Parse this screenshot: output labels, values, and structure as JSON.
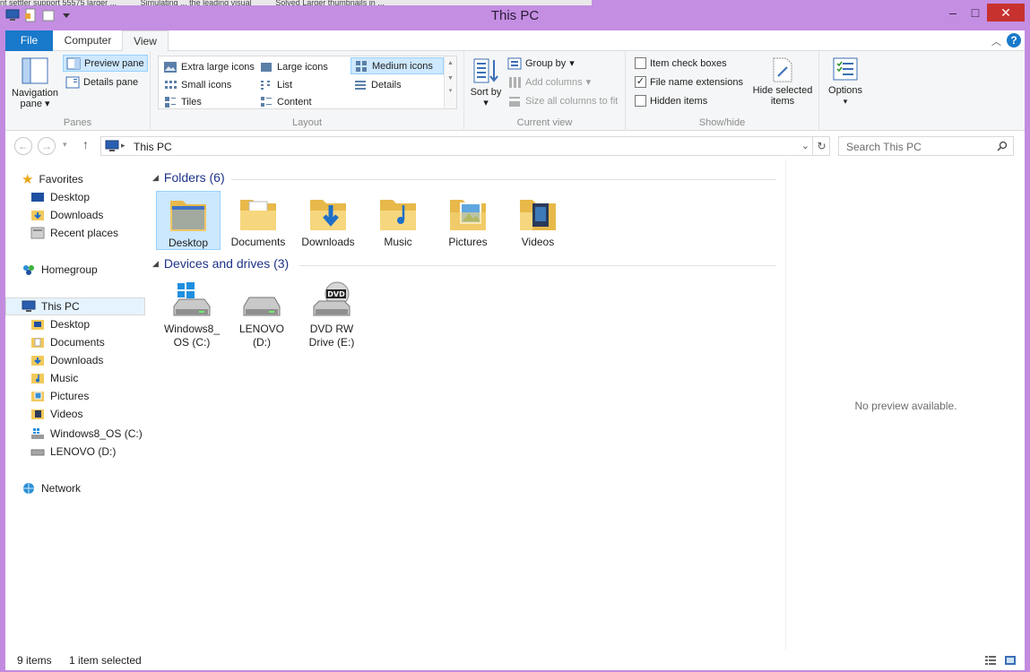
{
  "background_strip": [
    "nt settler support 55575 larger ...",
    "Simulating ... the leading visual",
    "Solved Larger thumbnails in ..."
  ],
  "window": {
    "title": "This PC",
    "minimize": "–",
    "maximize": "□",
    "close": "✕"
  },
  "ribbon": {
    "tabs": {
      "file": "File",
      "computer": "Computer",
      "view": "View"
    },
    "help": "?",
    "panes": {
      "label": "Panes",
      "navigation_pane": "Navigation pane",
      "preview_pane": "Preview pane",
      "details_pane": "Details pane"
    },
    "layout": {
      "label": "Layout",
      "extra_large_icons": "Extra large icons",
      "large_icons": "Large icons",
      "medium_icons": "Medium icons",
      "small_icons": "Small icons",
      "list": "List",
      "details": "Details",
      "tiles": "Tiles",
      "content": "Content"
    },
    "current_view": {
      "label": "Current view",
      "sort_by": "Sort by",
      "group_by": "Group by",
      "add_columns": "Add columns",
      "size_all_columns": "Size all columns to fit"
    },
    "show_hide": {
      "label": "Show/hide",
      "item_check_boxes": "Item check boxes",
      "file_name_extensions": "File name extensions",
      "hidden_items": "Hidden items",
      "hide_selected_items": "Hide selected items"
    },
    "options": "Options"
  },
  "address": {
    "path": "This PC",
    "search_placeholder": "Search This PC"
  },
  "nav": {
    "favorites": "Favorites",
    "fav_items": [
      "Desktop",
      "Downloads",
      "Recent places"
    ],
    "homegroup": "Homegroup",
    "this_pc": "This PC",
    "pc_items": [
      "Desktop",
      "Documents",
      "Downloads",
      "Music",
      "Pictures",
      "Videos",
      "Windows8_OS (C:)",
      "LENOVO (D:)"
    ],
    "network": "Network"
  },
  "main": {
    "folders_header": "Folders (6)",
    "folders": [
      "Desktop",
      "Documents",
      "Downloads",
      "Music",
      "Pictures",
      "Videos"
    ],
    "devices_header": "Devices and drives (3)",
    "drives": [
      {
        "line1": "Windows8_",
        "line2": "OS (C:)"
      },
      {
        "line1": "LENOVO",
        "line2": "(D:)"
      },
      {
        "line1": "DVD RW",
        "line2": "Drive (E:)"
      }
    ],
    "dvd_logo": "DVD"
  },
  "preview": {
    "message": "No preview available."
  },
  "status": {
    "items": "9 items",
    "selected": "1 item selected"
  },
  "colors": {
    "accent": "#1979ca",
    "frame": "#c48ee3",
    "selection": "#cce8ff",
    "folder": "#f2c95c"
  }
}
